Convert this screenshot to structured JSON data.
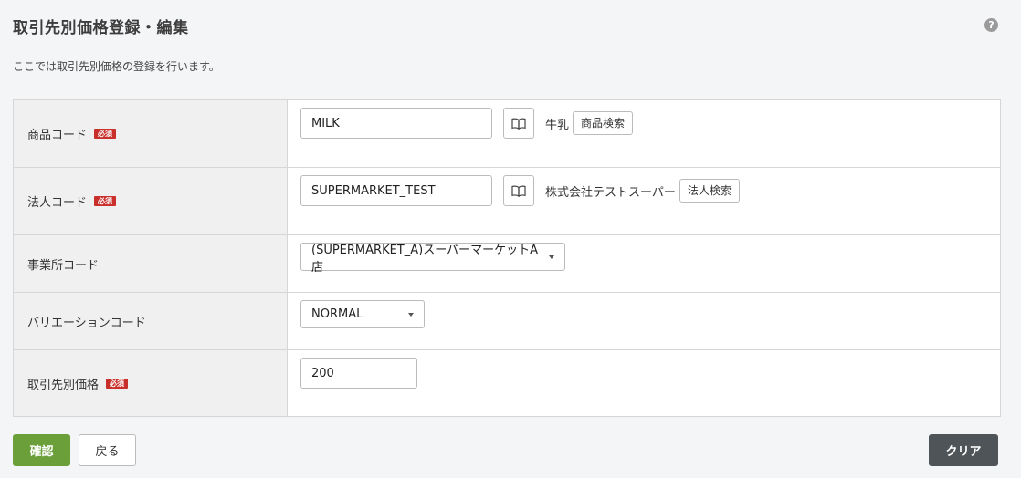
{
  "header": {
    "title": "取引先別価格登録・編集",
    "help_icon": "question-circle-icon",
    "description": "ここでは取引先別価格の登録を行います。"
  },
  "form": {
    "required_badge": "必須",
    "product": {
      "label": "商品コード",
      "value": "MILK",
      "lookup_icon": "book-icon",
      "ref_name": "牛乳",
      "search_label": "商品検索"
    },
    "corporation": {
      "label": "法人コード",
      "value": "SUPERMARKET_TEST",
      "lookup_icon": "book-icon",
      "ref_name": "株式会社テストスーパー",
      "search_label": "法人検索"
    },
    "office": {
      "label": "事業所コード",
      "selected": "(SUPERMARKET_A)スーパーマーケットA店"
    },
    "variation": {
      "label": "バリエーションコード",
      "selected": "NORMAL"
    },
    "price": {
      "label": "取引先別価格",
      "value": "200"
    }
  },
  "actions": {
    "confirm_label": "確認",
    "back_label": "戻る",
    "clear_label": "クリア"
  },
  "colors": {
    "confirm": "#6a9f3a",
    "clear": "#4f5459",
    "required": "#c9302c"
  }
}
